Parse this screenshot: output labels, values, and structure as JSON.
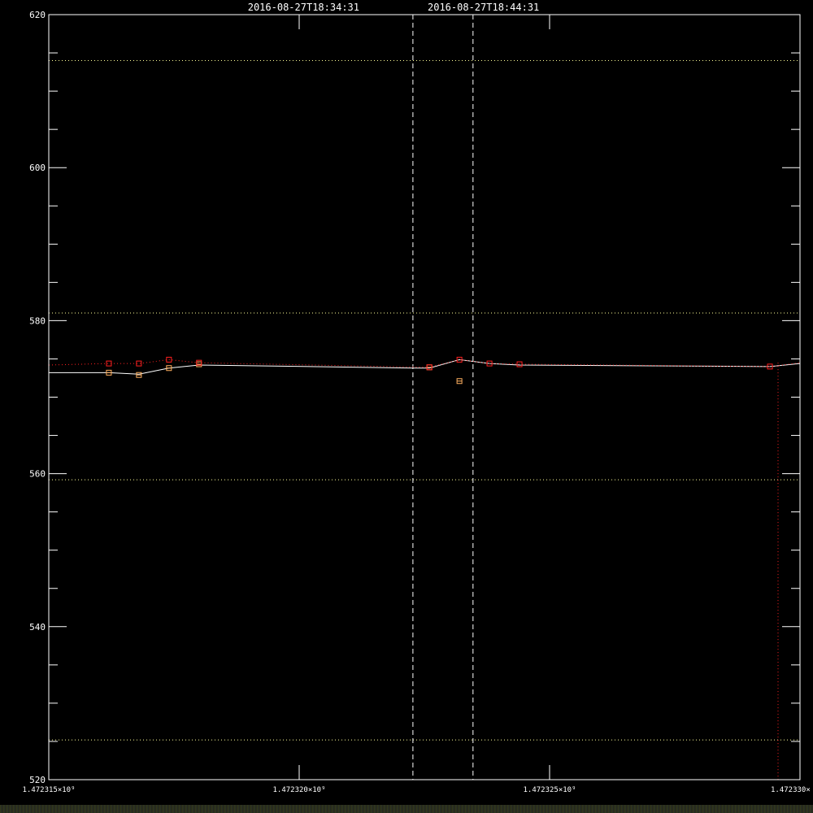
{
  "title": {
    "start_time": "2016-08-27T18:34:31",
    "end_time": "2016-08-27T18:44:31"
  },
  "colors": {
    "background": "#000000",
    "axis": "#ffffff",
    "series_main": "#ffffff",
    "series_orange": "#ffb060",
    "series_red": "#ff2020",
    "reference_lines": "#ffff99"
  },
  "chart_data": {
    "type": "line",
    "title": "",
    "xlabel": "",
    "ylabel": "",
    "xlim": [
      1472315000,
      1472330000
    ],
    "ylim": [
      520,
      620
    ],
    "x_ticks": [
      {
        "value": 1472315000,
        "label": "1.472315×10⁹"
      },
      {
        "value": 1472320000,
        "label": "1.472320×10⁹"
      },
      {
        "value": 1472325000,
        "label": "1.472325×10⁹"
      },
      {
        "value": 1472330000,
        "label": "1.472330×"
      }
    ],
    "y_ticks": [
      {
        "value": 520,
        "label": "520"
      },
      {
        "value": 540,
        "label": "540"
      },
      {
        "value": 560,
        "label": "560"
      },
      {
        "value": 580,
        "label": "580"
      },
      {
        "value": 600,
        "label": "600"
      },
      {
        "value": 620,
        "label": "620"
      }
    ],
    "y_minor_ticks": [
      525,
      530,
      535,
      545,
      550,
      555,
      565,
      570,
      575,
      585,
      590,
      595,
      605,
      610,
      615
    ],
    "reference_levels": [
      525.2,
      559.2,
      581.0,
      614.0
    ],
    "time_markers": [
      1472322271,
      1472323471
    ],
    "series": [
      {
        "style": "solid",
        "color": "#ffffff",
        "x": [
          1472315000,
          1472316200,
          1472316800,
          1472317400,
          1472318000,
          1472322300,
          1472322600,
          1472323200,
          1472323800,
          1472324400,
          1472329400,
          1472330000
        ],
        "y": [
          573.2,
          573.2,
          573.0,
          573.8,
          574.2,
          573.8,
          573.8,
          574.9,
          574.4,
          574.2,
          574.0,
          574.4
        ]
      },
      {
        "style": "markers",
        "color": "#ffb060",
        "x": [
          1472316200,
          1472316800,
          1472317400,
          1472318000,
          1472322600,
          1472323200
        ],
        "y": [
          573.2,
          572.9,
          573.8,
          574.3,
          573.9,
          572.1
        ]
      },
      {
        "style": "dotted-markers",
        "color": "#ff2020",
        "x": [
          1472315000,
          1472316200,
          1472316800,
          1472317400,
          1472318000,
          1472322600,
          1472323200,
          1472323800,
          1472324400,
          1472329400,
          1472330000
        ],
        "y": [
          574.2,
          574.4,
          574.4,
          574.9,
          574.5,
          573.9,
          574.9,
          574.4,
          574.3,
          574.0,
          574.5
        ]
      }
    ]
  }
}
